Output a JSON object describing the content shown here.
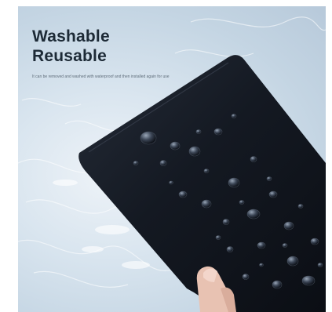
{
  "headline": {
    "line1": "Washable",
    "line2": "Reusable"
  },
  "caption": "It can be removed and washed with waterproof and then installed again for use",
  "colors": {
    "water_light": "#eef3f8",
    "water_dark": "#b7c9da",
    "mat": "#141922",
    "headline_text": "#1d2a36",
    "skin": "#e8c2b2"
  },
  "icons": {
    "mat": "black-rubber-mat",
    "hand": "hand-holding-mat",
    "droplets": "water-droplets"
  }
}
